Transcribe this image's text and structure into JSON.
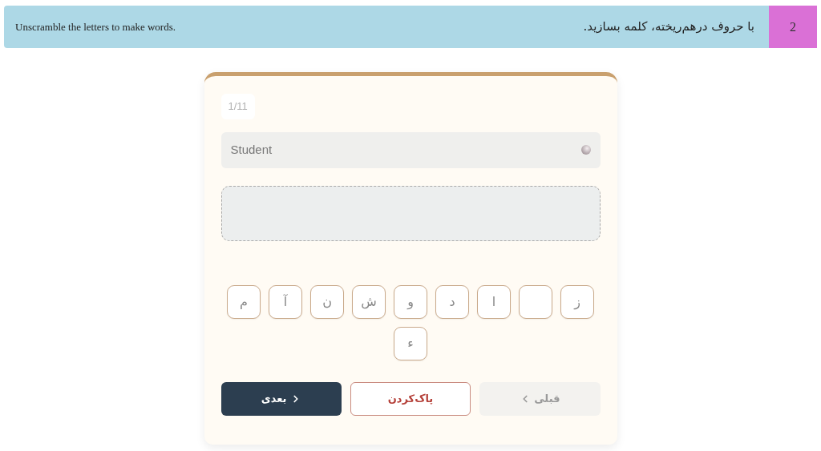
{
  "header": {
    "instruction_en": "Unscramble the letters to make words.",
    "instruction_fa": "با حروف درهم‌ریخته، کلمه بسازید.",
    "number": "2"
  },
  "card": {
    "counter": "1/11",
    "role_field": {
      "value": "Student"
    },
    "letters": [
      {
        "kind": "letter",
        "text": "ز"
      },
      {
        "kind": "blank"
      },
      {
        "kind": "letter",
        "text": "ا"
      },
      {
        "kind": "letter",
        "text": "د"
      },
      {
        "kind": "letter",
        "text": "و"
      },
      {
        "kind": "letter",
        "text": "ش"
      },
      {
        "kind": "letter",
        "text": "ن"
      },
      {
        "kind": "letter",
        "text": "آ"
      },
      {
        "kind": "letter",
        "text": "م"
      },
      {
        "kind": "letter",
        "text": "ء"
      }
    ],
    "buttons": [
      {
        "kind": "previous",
        "label": "قبلی",
        "disabled": true
      },
      {
        "kind": "clear",
        "label": "پاک‌کردن",
        "disabled": false
      },
      {
        "kind": "next",
        "label": "بعدی",
        "disabled": false
      }
    ]
  }
}
